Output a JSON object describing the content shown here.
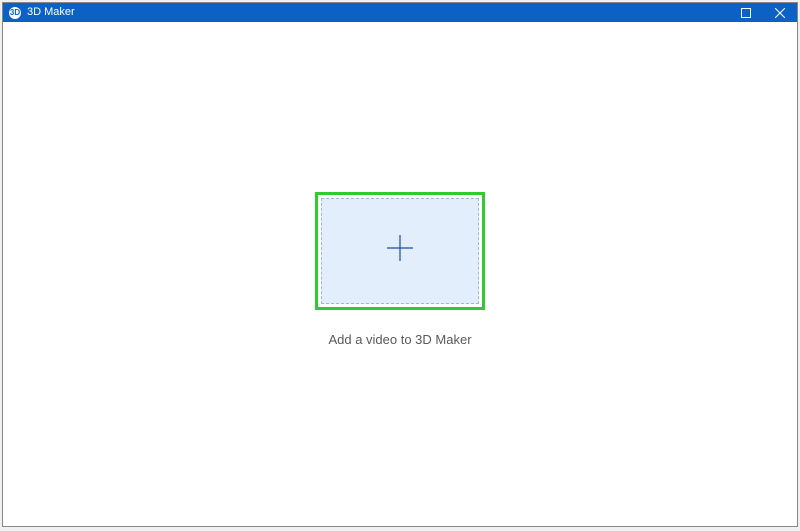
{
  "titlebar": {
    "icon_label": "3D",
    "title": "3D Maker"
  },
  "main": {
    "hint_text": "Add a video to 3D Maker"
  },
  "colors": {
    "accent": "#0b62c4",
    "highlight": "#2ecc2e",
    "dropzone_bg": "#e3eefc"
  }
}
